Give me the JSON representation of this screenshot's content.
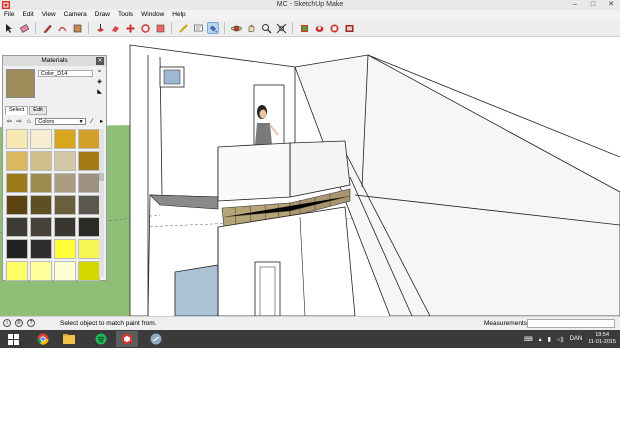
{
  "window": {
    "title": "MC - SketchUp Make",
    "controls": {
      "minimize": "–",
      "maximize": "□",
      "close": "✕"
    }
  },
  "menu": [
    "File",
    "Edit",
    "View",
    "Camera",
    "Draw",
    "Tools",
    "Window",
    "Help"
  ],
  "toolbar": {
    "icons": [
      "select-icon",
      "eraser-icon",
      "pencil-icon",
      "arc-icon",
      "rectangle-icon",
      "push-pull-icon",
      "follow-me-icon",
      "move-icon",
      "rotate-icon",
      "scale-icon",
      "tape-measure-icon",
      "text-icon",
      "paint-bucket-icon",
      "orbit-icon",
      "pan-icon",
      "zoom-icon",
      "zoom-extents-icon",
      "warehouse-icon",
      "share-model-icon",
      "extension-icon",
      "layout-icon"
    ],
    "active": "paint-bucket-icon"
  },
  "materials": {
    "title": "Materials",
    "current_name": "Color_D14",
    "current_color": "#a08b5a",
    "tabs": [
      "Select",
      "Edit"
    ],
    "selected_tab": "Select",
    "library": "Colors",
    "swatches": [
      "#f8e8b4",
      "#f7edd2",
      "#d9a51c",
      "#d29f2a",
      "#d9b85f",
      "#d2be8a",
      "#d6c7a8",
      "#a37c18",
      "#9c7a1c",
      "#9c8a4e",
      "#a99c80",
      "#9c9180",
      "#5c4412",
      "#5c5024",
      "#6b5e3e",
      "#5a5650",
      "#3e3a34",
      "#46423a",
      "#3a3630",
      "#2c2a26",
      "#222222",
      "#2e2e2e",
      "#ffff3a",
      "#f6f652",
      "#ffff66",
      "#ffff9a",
      "#ffffd6",
      "#d6d600"
    ]
  },
  "status": {
    "message": "Select object to match paint from.",
    "measurements_label": "Measurements",
    "measurements_value": ""
  },
  "taskbar": {
    "apps": [
      "windows-start-icon",
      "chrome-icon",
      "file-explorer-icon",
      "spotify-icon",
      "sketchup-icon",
      "other-app-icon"
    ],
    "active_app": "sketchup-icon",
    "language": "DAN",
    "time": "18:54",
    "date": "11-01-2015"
  },
  "colors": {
    "grass": "#8fbf77",
    "sky": "#ffffff",
    "wall": "#ffffff",
    "wall_shade": "#e9e9e9",
    "glass": "#f2f2f2",
    "planter": "#b5a47a",
    "door_glass": "#a9c2d6",
    "taskbar": "#3a3a3a"
  }
}
